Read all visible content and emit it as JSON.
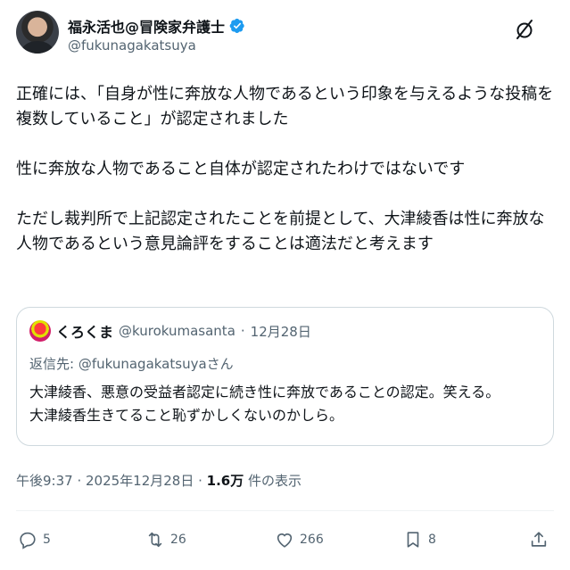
{
  "author": {
    "display_name": "福永活也@冒険家弁護士",
    "handle": "@fukunagakatsuya",
    "verified": true,
    "verified_color": "#1d9bf0"
  },
  "tweet": {
    "lines": [
      "正確には、「自身が性に奔放な人物であるという印象を与えるような投稿を複数していること」が認定されました",
      "",
      "性に奔放な人物であること自体が認定されたわけではないです",
      "",
      "ただし裁判所で上記認定されたことを前提として、大津綾香は性に奔放な人物であるという意見論評をすることは適法だと考えます"
    ]
  },
  "quote": {
    "display_name": "くろくま",
    "handle": "@kurokumasanta",
    "separator": "·",
    "date": "12月28日",
    "reply_prefix": "返信先: ",
    "reply_to": "@fukunagakatsuya",
    "reply_suffix": "さん",
    "lines": [
      "大津綾香、悪意の受益者認定に続き性に奔放であることの認定。笑える。",
      "大津綾香生きてること恥ずかしくないのかしら。"
    ]
  },
  "meta": {
    "time_date": "午後9:37 · 2025年12月28日 · ",
    "views_count": "1.6万",
    "views_label": " 件の表示"
  },
  "actions": {
    "replies": "5",
    "reposts": "26",
    "likes": "266",
    "bookmarks": "8"
  },
  "icons": {
    "grok": "grok-icon",
    "reply": "reply-icon",
    "repost": "repost-icon",
    "like": "heart-icon",
    "bookmark": "bookmark-icon",
    "share": "share-icon"
  }
}
